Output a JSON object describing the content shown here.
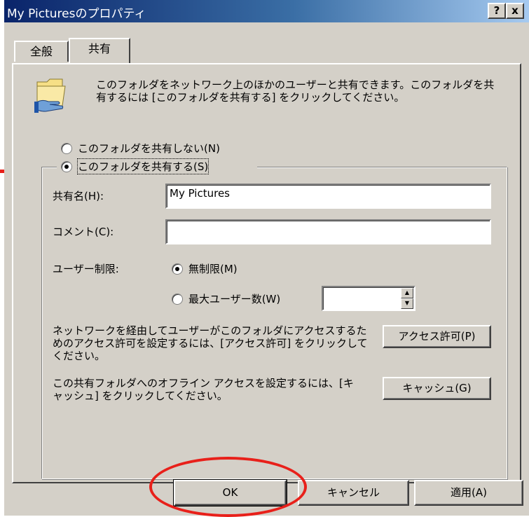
{
  "window": {
    "title": "My Picturesのプロパティ",
    "help_button": "?",
    "close_button": "x"
  },
  "tabs": [
    {
      "label": "全般"
    },
    {
      "label": "共有"
    }
  ],
  "intro": {
    "text": "このフォルダをネットワーク上のほかのユーザーと共有できます。このフォルダを共有するには [このフォルダを共有する] をクリックしてください。"
  },
  "share_options": {
    "no_share": "このフォルダを共有しない(N)",
    "share": "このフォルダを共有する(S)",
    "selected": "share"
  },
  "share_name": {
    "label": "共有名(H):",
    "value": "My Pictures"
  },
  "comment": {
    "label": "コメント(C):",
    "value": ""
  },
  "user_limit": {
    "label": "ユーザー制限:",
    "unlimited": "無制限(M)",
    "max_users": "最大ユーザー数(W)",
    "selected": "unlimited",
    "max_value": ""
  },
  "permissions": {
    "text": "ネットワークを経由してユーザーがこのフォルダにアクセスするためのアクセス許可を設定するには、[アクセス許可] をクリックしてください。",
    "button": "アクセス許可(P)"
  },
  "caching": {
    "text": "この共有フォルダへのオフライン アクセスを設定するには、[キャッシュ] をクリックしてください。",
    "button": "キャッシュ(G)"
  },
  "footer": {
    "ok": "OK",
    "cancel": "キャンセル",
    "apply": "適用(A)"
  },
  "colors": {
    "annotation": "#e8201a",
    "dialog_face": "#d4d0c8",
    "title_start": "#0a246a"
  }
}
